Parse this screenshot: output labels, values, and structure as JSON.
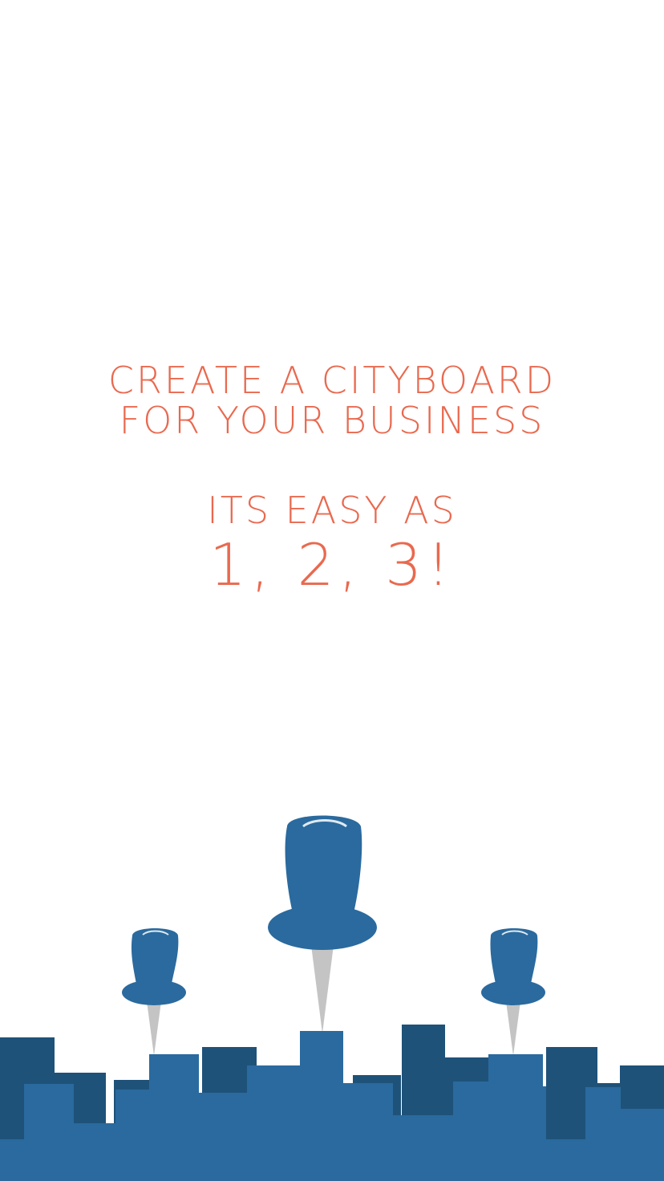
{
  "intro": {
    "line1": "CREATE A CITYBOARD",
    "line2": "FOR YOUR BUSINESS",
    "line3": "ITS EASY AS",
    "line4": "1, 2, 3!"
  },
  "colors": {
    "text_accent": "#E9694F",
    "pin_blue": "#2A6A9E",
    "skyline_dark": "#1E5279",
    "skyline_light": "#2A6A9E",
    "pin_needle": "#C4C4C4",
    "background": "#FFFFFF"
  },
  "illustration": {
    "pins": [
      "pushpin-icon",
      "pushpin-icon",
      "pushpin-icon"
    ],
    "skyline": "city-skyline-icon"
  }
}
